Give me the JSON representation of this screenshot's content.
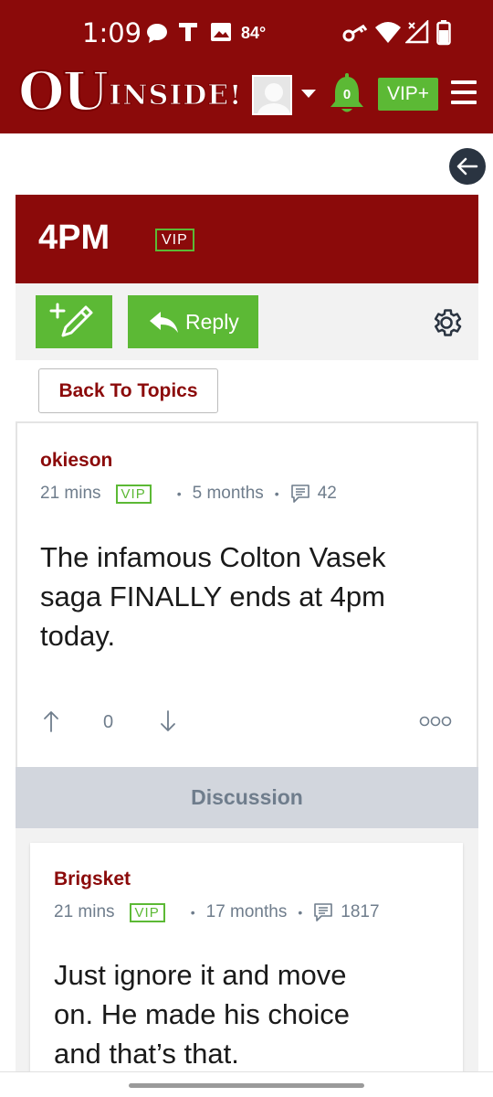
{
  "status_bar": {
    "time": "1:09",
    "temperature": "84°"
  },
  "header": {
    "logo_ou": "OU",
    "logo_inside": "INSIDE!",
    "notification_count": "0",
    "vip_plus_label": "VIP+"
  },
  "topic": {
    "title": "4PM",
    "badge": "VIP"
  },
  "actions": {
    "reply_label": "Reply",
    "back_to_topics_label": "Back To Topics"
  },
  "post": {
    "author": "okieson",
    "time_ago": "21 mins",
    "badge": "VIP",
    "member_for": "5 months",
    "comment_count": "42",
    "body_lines": [
      "The infamous Colton Vasek",
      "saga FINALLY ends at 4pm",
      "today."
    ],
    "vote_count": "0"
  },
  "discussion_label": "Discussion",
  "reply": {
    "author": "Brigsket",
    "time_ago": "21 mins",
    "badge": "VIP",
    "member_for": "17 months",
    "comment_count": "1817",
    "body_lines": [
      "Just ignore it and move",
      "on. He made his choice",
      "and that’s that."
    ]
  },
  "colors": {
    "brand_red": "#8b0a0a",
    "accent_green": "#5cb935",
    "meta_gray": "#6f7d8c"
  },
  "icons": [
    "chat-bubble-icon",
    "t-icon",
    "image-icon",
    "key-icon",
    "wifi-icon",
    "no-signal-icon",
    "battery-icon",
    "bell-icon",
    "menu-icon",
    "back-arrow-icon",
    "new-topic-icon",
    "reply-arrow-icon",
    "gear-icon",
    "comment-icon",
    "upvote-icon",
    "downvote-icon",
    "more-options-icon"
  ]
}
